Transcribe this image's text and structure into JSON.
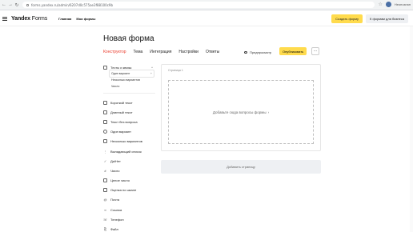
{
  "browser": {
    "url": "forms.yandex.ru/admin/6207d0c575ae3f88100c9b",
    "profile": "Неопознан"
  },
  "header": {
    "logo_main": "Yandex",
    "logo_sub": "Forms",
    "nav": [
      "Главная",
      "Мои формы"
    ],
    "create_label": "Создать форму",
    "business_label": "К формам для бизнеса"
  },
  "page": {
    "title": "Новая форма",
    "tabs": [
      "Конструктор",
      "Тема",
      "Интеграция",
      "Настройки",
      "Ответы"
    ],
    "active_tab": "Конструктор",
    "preview_label": "Предпросмотр",
    "publish_label": "Опубликовать",
    "more_label": "···"
  },
  "sidebar": {
    "group_label": "Тесты и квизы",
    "group_items": [
      "Один вариант",
      "Несколько вариантов",
      "Число"
    ],
    "items": [
      {
        "label": "Короткий текст",
        "icon": "short-text-icon"
      },
      {
        "label": "Длинный текст",
        "icon": "long-text-icon"
      },
      {
        "label": "Текст без вопроса",
        "icon": "text-icon"
      },
      {
        "label": "Один вариант",
        "icon": "radio-icon"
      },
      {
        "label": "Несколько вариантов",
        "icon": "checkbox-icon"
      },
      {
        "label": "Выпадающий список",
        "icon": "dropdown-icon"
      },
      {
        "label": "Да/Нет",
        "icon": "check-icon"
      },
      {
        "label": "Число",
        "icon": "number-icon"
      },
      {
        "label": "Целое число",
        "icon": "integer-icon"
      },
      {
        "label": "Оценка по шкале",
        "icon": "scale-icon"
      },
      {
        "label": "Почта",
        "icon": "mail-icon"
      },
      {
        "label": "Ссылка",
        "icon": "link-icon"
      },
      {
        "label": "Телефон",
        "icon": "phone-icon"
      },
      {
        "label": "Файл",
        "icon": "file-icon"
      }
    ]
  },
  "canvas": {
    "page_label": "Страница 1",
    "dropzone_text": "Добавьте сюда вопросы формы",
    "add_page_label": "Добавить страницу"
  },
  "colors": {
    "accent_yellow": "#ffdb4d",
    "active_tab_red": "#ea3a2a"
  }
}
